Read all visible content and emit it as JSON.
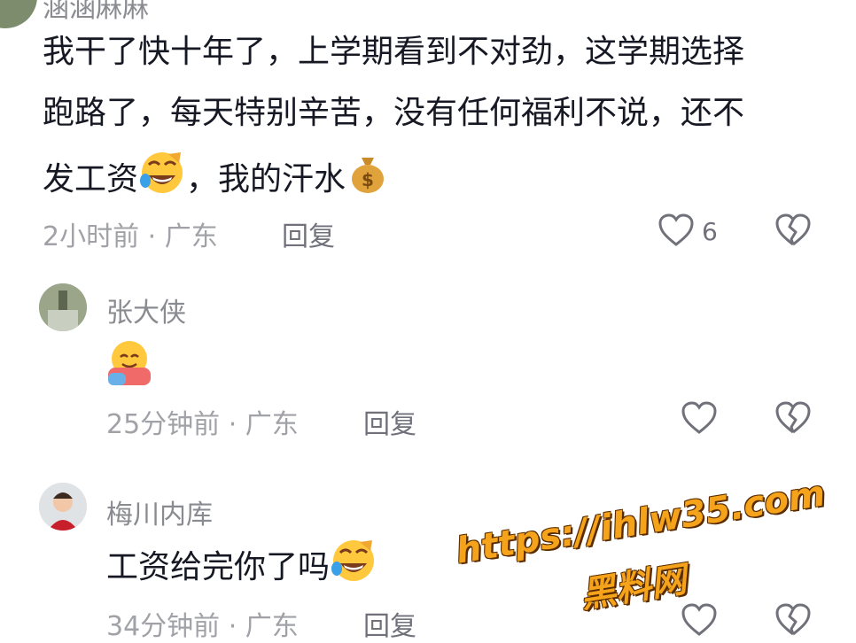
{
  "comments": [
    {
      "username": "涵涵麻麻",
      "text_lines": [
        "我干了快十年了，上学期看到不对劲，这学期选择",
        "跑路了，每天特别辛苦，没有任何福利不说，还不"
      ],
      "text_line3_part1": "发工资",
      "text_line3_part2": "，我的汗水",
      "meta": "2小时前 · 广东",
      "reply_label": "回复",
      "like_count": "6",
      "emojis": [
        "laughing-crying-emoji",
        "money-bag-emoji"
      ]
    },
    {
      "username": "张大侠",
      "emojis": [
        "hug-emoji"
      ],
      "meta": "25分钟前 · 广东",
      "reply_label": "回复"
    },
    {
      "username": "梅川内库",
      "text": "工资给完你了吗",
      "emojis": [
        "laughing-crying-emoji"
      ],
      "meta": "34分钟前 · 广东",
      "reply_label": "回复"
    }
  ],
  "watermark": {
    "url": "https://ihlw35.com",
    "name": "黑料网"
  },
  "colors": {
    "text": "#161823",
    "meta": "#a1a2a7",
    "watermark": "#f5a31a"
  }
}
